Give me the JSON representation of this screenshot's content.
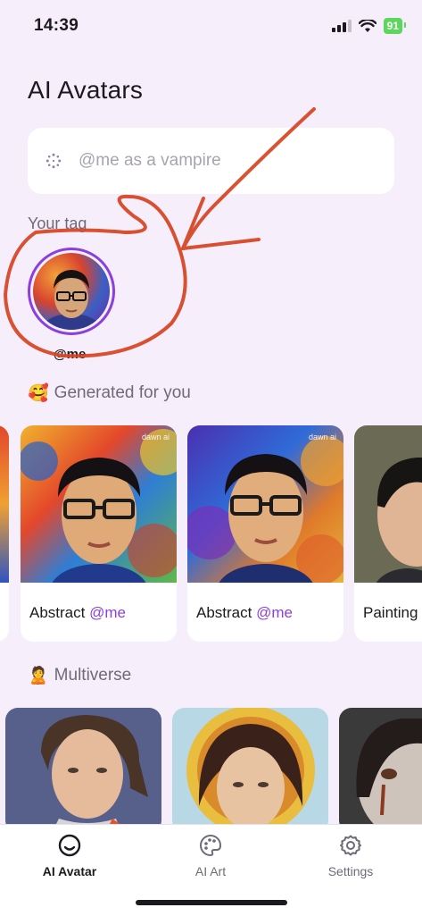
{
  "status_bar": {
    "time": "14:39",
    "battery": "91"
  },
  "header": {
    "title": "AI Avatars"
  },
  "search": {
    "placeholder": "@me as a vampire"
  },
  "your_tag": {
    "label": "Your tag",
    "name": "@me"
  },
  "generated": {
    "emoji": "🥰",
    "title": "Generated for you",
    "cards": [
      {
        "style": "Abstract",
        "tag": "@me",
        "watermark": "dawn ai"
      },
      {
        "style": "Abstract",
        "tag": "@me",
        "watermark": "dawn ai"
      },
      {
        "style": "Painting",
        "tag": ""
      }
    ]
  },
  "multiverse": {
    "emoji": "🙎",
    "title": "Multiverse"
  },
  "tabs": [
    {
      "label": "AI Avatar",
      "icon": "smile-icon",
      "active": true
    },
    {
      "label": "AI Art",
      "icon": "palette-icon",
      "active": false
    },
    {
      "label": "Settings",
      "icon": "gear-icon",
      "active": false
    }
  ],
  "colors": {
    "accent": "#8b3fe0",
    "background": "#f6effb",
    "annotation": "#d64321"
  }
}
